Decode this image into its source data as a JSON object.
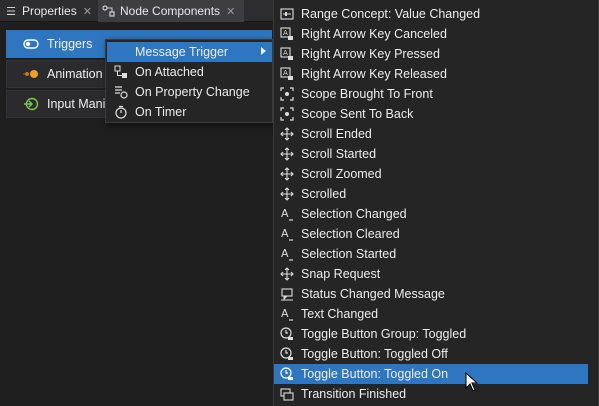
{
  "tabs": [
    {
      "label": "Properties",
      "icon": "list-icon"
    },
    {
      "label": "Node Components",
      "icon": "node-icon"
    }
  ],
  "components": [
    {
      "label": "Triggers",
      "icon": "trigger-icon",
      "active": true
    },
    {
      "label": "Animation",
      "icon": "animation-icon",
      "active": false
    },
    {
      "label": "Input Mani",
      "icon": "input-icon",
      "active": false
    }
  ],
  "submenu": [
    {
      "label": "Message Trigger",
      "icon": "",
      "selected": true,
      "has_submenu": true
    },
    {
      "label": "On Attached",
      "icon": "attach-icon"
    },
    {
      "label": "On Property Change",
      "icon": "property-icon"
    },
    {
      "label": "On Timer",
      "icon": "timer-icon"
    }
  ],
  "messages": [
    {
      "label": "Range Concept: Value Changed",
      "icon": "slider-icon"
    },
    {
      "label": "Right Arrow Key Canceled",
      "icon": "key-icon"
    },
    {
      "label": "Right Arrow Key Pressed",
      "icon": "key-icon"
    },
    {
      "label": "Right Arrow Key Released",
      "icon": "key-icon"
    },
    {
      "label": "Scope Brought To Front",
      "icon": "scope-icon"
    },
    {
      "label": "Scope Sent To Back",
      "icon": "scope-icon"
    },
    {
      "label": "Scroll Ended",
      "icon": "move-icon"
    },
    {
      "label": "Scroll Started",
      "icon": "move-icon"
    },
    {
      "label": "Scroll Zoomed",
      "icon": "move-icon"
    },
    {
      "label": "Scrolled",
      "icon": "move-icon"
    },
    {
      "label": "Selection Changed",
      "icon": "text-icon"
    },
    {
      "label": "Selection Cleared",
      "icon": "text-icon"
    },
    {
      "label": "Selection Started",
      "icon": "text-icon"
    },
    {
      "label": "Snap Request",
      "icon": "move-icon"
    },
    {
      "label": "Status Changed Message",
      "icon": "status-icon"
    },
    {
      "label": "Text Changed",
      "icon": "text-icon"
    },
    {
      "label": "Toggle Button Group: Toggled",
      "icon": "toggle-icon"
    },
    {
      "label": "Toggle Button: Toggled Off",
      "icon": "toggle-icon"
    },
    {
      "label": "Toggle Button: Toggled On",
      "icon": "toggle-icon",
      "selected": true
    },
    {
      "label": "Transition Finished",
      "icon": "transition-icon"
    }
  ],
  "colors": {
    "accent": "#2e77c0",
    "background": "#1e1e1e",
    "menu_background": "#252526"
  }
}
